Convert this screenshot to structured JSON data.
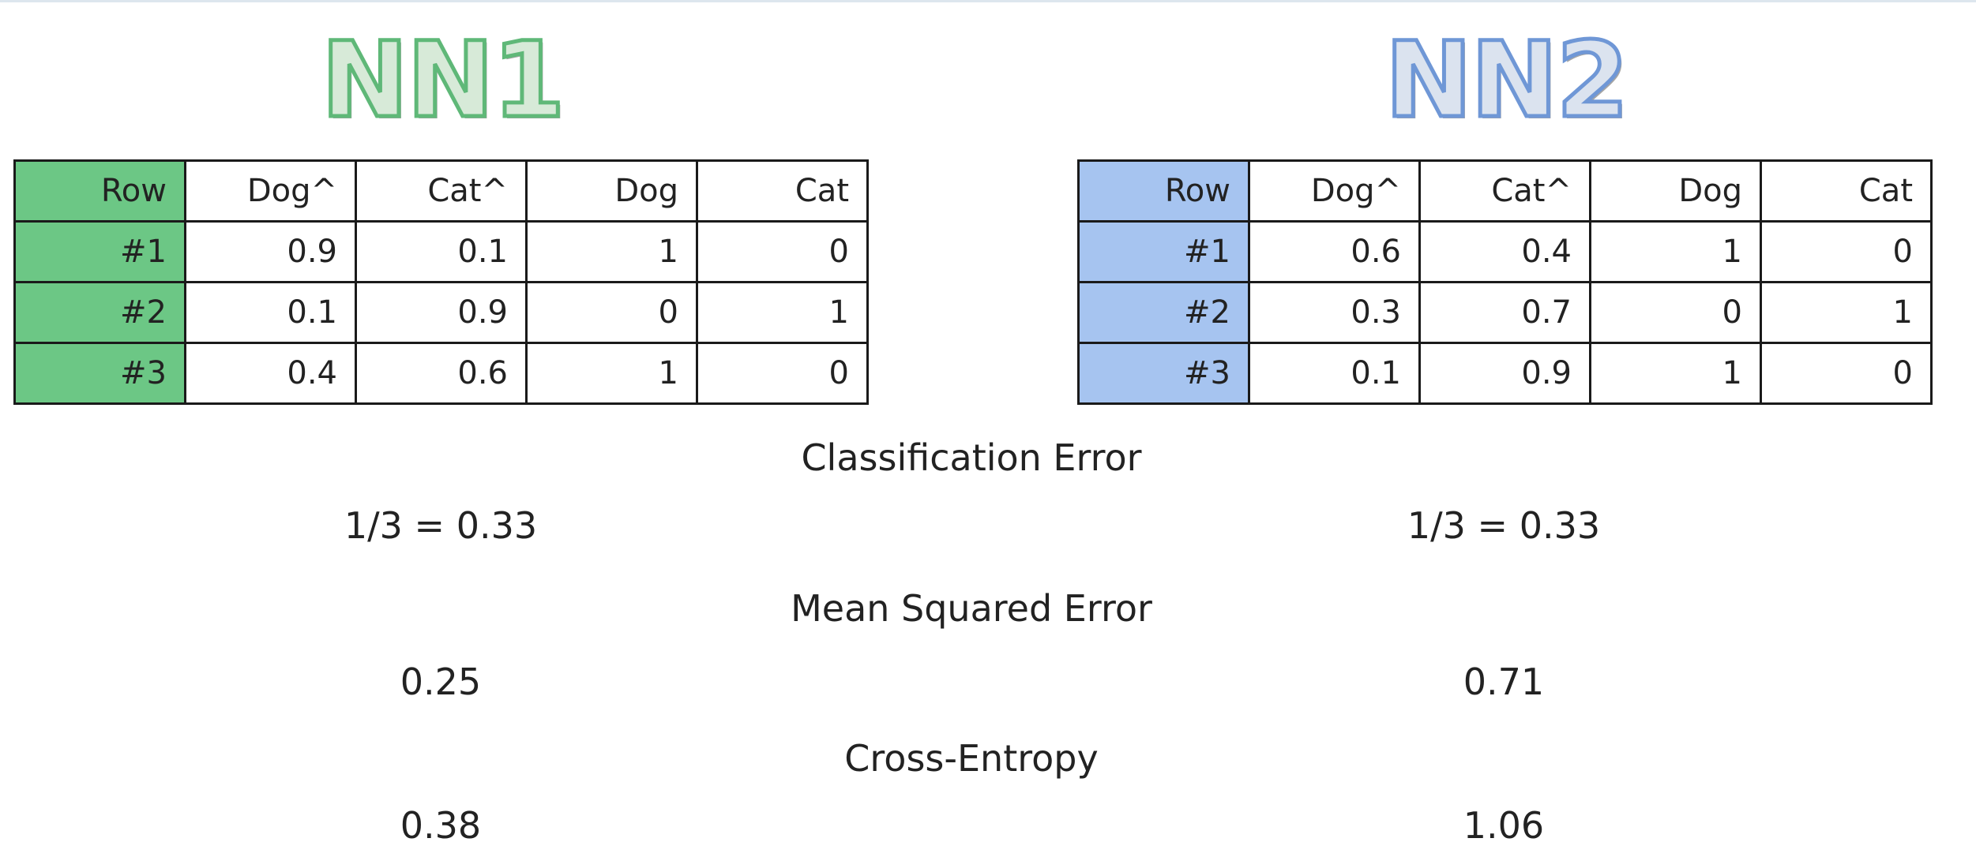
{
  "nn1": {
    "title": "NN1",
    "color": "#6cc785",
    "headers": [
      "Row",
      "Dog^",
      "Cat^",
      "Dog",
      "Cat"
    ],
    "rows": [
      [
        "#1",
        "0.9",
        "0.1",
        "1",
        "0"
      ],
      [
        "#2",
        "0.1",
        "0.9",
        "0",
        "1"
      ],
      [
        "#3",
        "0.4",
        "0.6",
        "1",
        "0"
      ]
    ],
    "classification_error": "1/3 = 0.33",
    "mean_squared_error": "0.25",
    "cross_entropy": "0.38"
  },
  "nn2": {
    "title": "NN2",
    "color": "#a6c4f0",
    "headers": [
      "Row",
      "Dog^",
      "Cat^",
      "Dog",
      "Cat"
    ],
    "rows": [
      [
        "#1",
        "0.6",
        "0.4",
        "1",
        "0"
      ],
      [
        "#2",
        "0.3",
        "0.7",
        "0",
        "1"
      ],
      [
        "#3",
        "0.1",
        "0.9",
        "1",
        "0"
      ]
    ],
    "classification_error": "1/3 = 0.33",
    "mean_squared_error": "0.71",
    "cross_entropy": "1.06"
  },
  "metrics": {
    "classification_error_label": "Classification Error",
    "mean_squared_error_label": "Mean Squared Error",
    "cross_entropy_label": "Cross-Entropy"
  }
}
